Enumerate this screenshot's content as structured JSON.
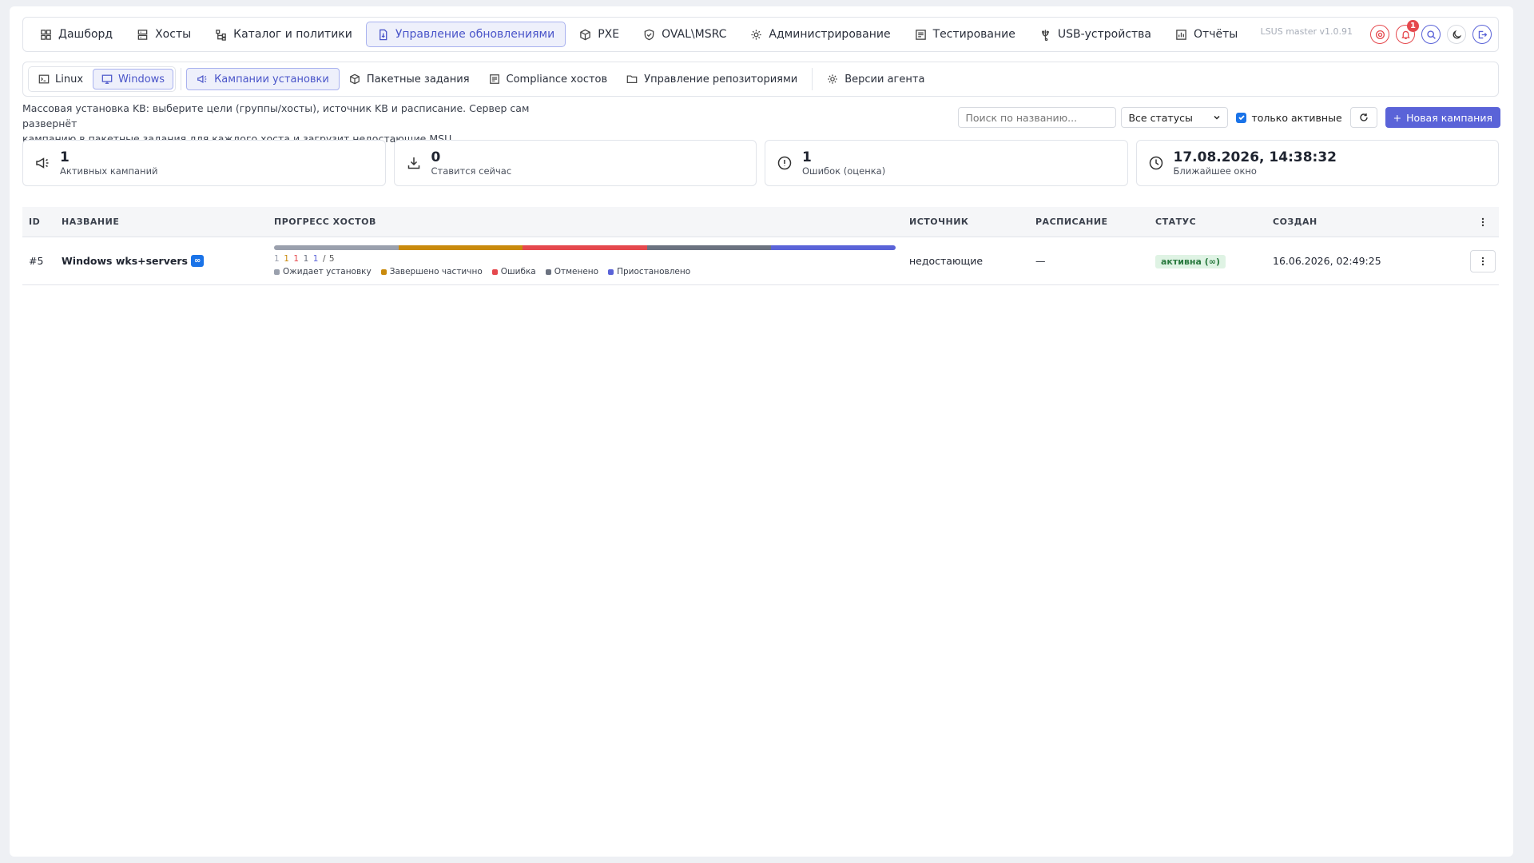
{
  "topnav": {
    "items": [
      {
        "label": "Дашборд",
        "icon": "grid-icon"
      },
      {
        "label": "Хосты",
        "icon": "server-icon"
      },
      {
        "label": "Каталог и политики",
        "icon": "hierarchy-icon"
      },
      {
        "label": "Управление обновлениями",
        "icon": "update-file-icon"
      },
      {
        "label": "PXE",
        "icon": "cube-icon"
      },
      {
        "label": "OVAL\\MSRC",
        "icon": "shield-icon"
      },
      {
        "label": "Администрирование",
        "icon": "gear-icon"
      },
      {
        "label": "Тестирование",
        "icon": "checklist-icon"
      },
      {
        "label": "USB-устройства",
        "icon": "usb-icon"
      },
      {
        "label": "Отчёты",
        "icon": "chart-icon"
      }
    ],
    "active_index": 3,
    "version": "LSUS master v1.0.91",
    "notification_count": "1"
  },
  "subnav": {
    "os": [
      {
        "label": "Linux",
        "icon": "terminal-icon"
      },
      {
        "label": "Windows",
        "icon": "monitor-icon"
      }
    ],
    "os_active_index": 1,
    "items": [
      {
        "label": "Кампании установки",
        "icon": "megaphone-icon"
      },
      {
        "label": "Пакетные задания",
        "icon": "package-icon"
      },
      {
        "label": "Compliance хостов",
        "icon": "checklist-icon"
      },
      {
        "label": "Управление репозиториями",
        "icon": "folder-icon"
      },
      {
        "label": "Версии агента",
        "icon": "gear-icon"
      }
    ],
    "active_index": 0
  },
  "description": {
    "line1": "Массовая установка KB: выберите цели (группы/хосты), источник KB и расписание. Сервер сам развернёт",
    "line2": "кампанию в пакетные задания для каждого хоста и загрузит недостающие MSU."
  },
  "toolbar": {
    "search_placeholder": "Поиск по названию...",
    "status_select": "Все статусы",
    "only_active_label": "только активные",
    "only_active_checked": true,
    "new_campaign_label": "Новая кампания"
  },
  "stats": [
    {
      "value": "1",
      "label": "Активных кампаний",
      "icon": "megaphone-icon"
    },
    {
      "value": "0",
      "label": "Ставится сейчас",
      "icon": "download-icon"
    },
    {
      "value": "1",
      "label": "Ошибок (оценка)",
      "icon": "alert-circle-icon"
    },
    {
      "value": "17.08.2026, 14:38:32",
      "label": "Ближайшее окно",
      "icon": "clock-icon"
    }
  ],
  "table": {
    "headers": {
      "id": "ID",
      "name": "НАЗВАНИЕ",
      "progress": "ПРОГРЕСС ХОСТОВ",
      "source": "ИСТОЧНИК",
      "schedule": "РАСПИСАНИЕ",
      "status": "СТАТУС",
      "created": "СОЗДАН"
    },
    "rows": [
      {
        "id": "#5",
        "name": "Windows wks+servers",
        "badge": "∞",
        "progress": {
          "segments": [
            {
              "label": "Ожидает установку",
              "count": "1",
              "color": "#9aa0ad"
            },
            {
              "label": "Завершено частично",
              "count": "1",
              "color": "#c98a0c"
            },
            {
              "label": "Ошибка",
              "count": "1",
              "color": "#e5484d"
            },
            {
              "label": "Отменено",
              "count": "1",
              "color": "#6b7280"
            },
            {
              "label": "Приостановлено",
              "count": "1",
              "color": "#5a63d8"
            }
          ],
          "total": "/ 5"
        },
        "source": "недостающие",
        "schedule": "—",
        "status": "активна (∞)",
        "created": "16.06.2026, 02:49:25"
      }
    ]
  }
}
